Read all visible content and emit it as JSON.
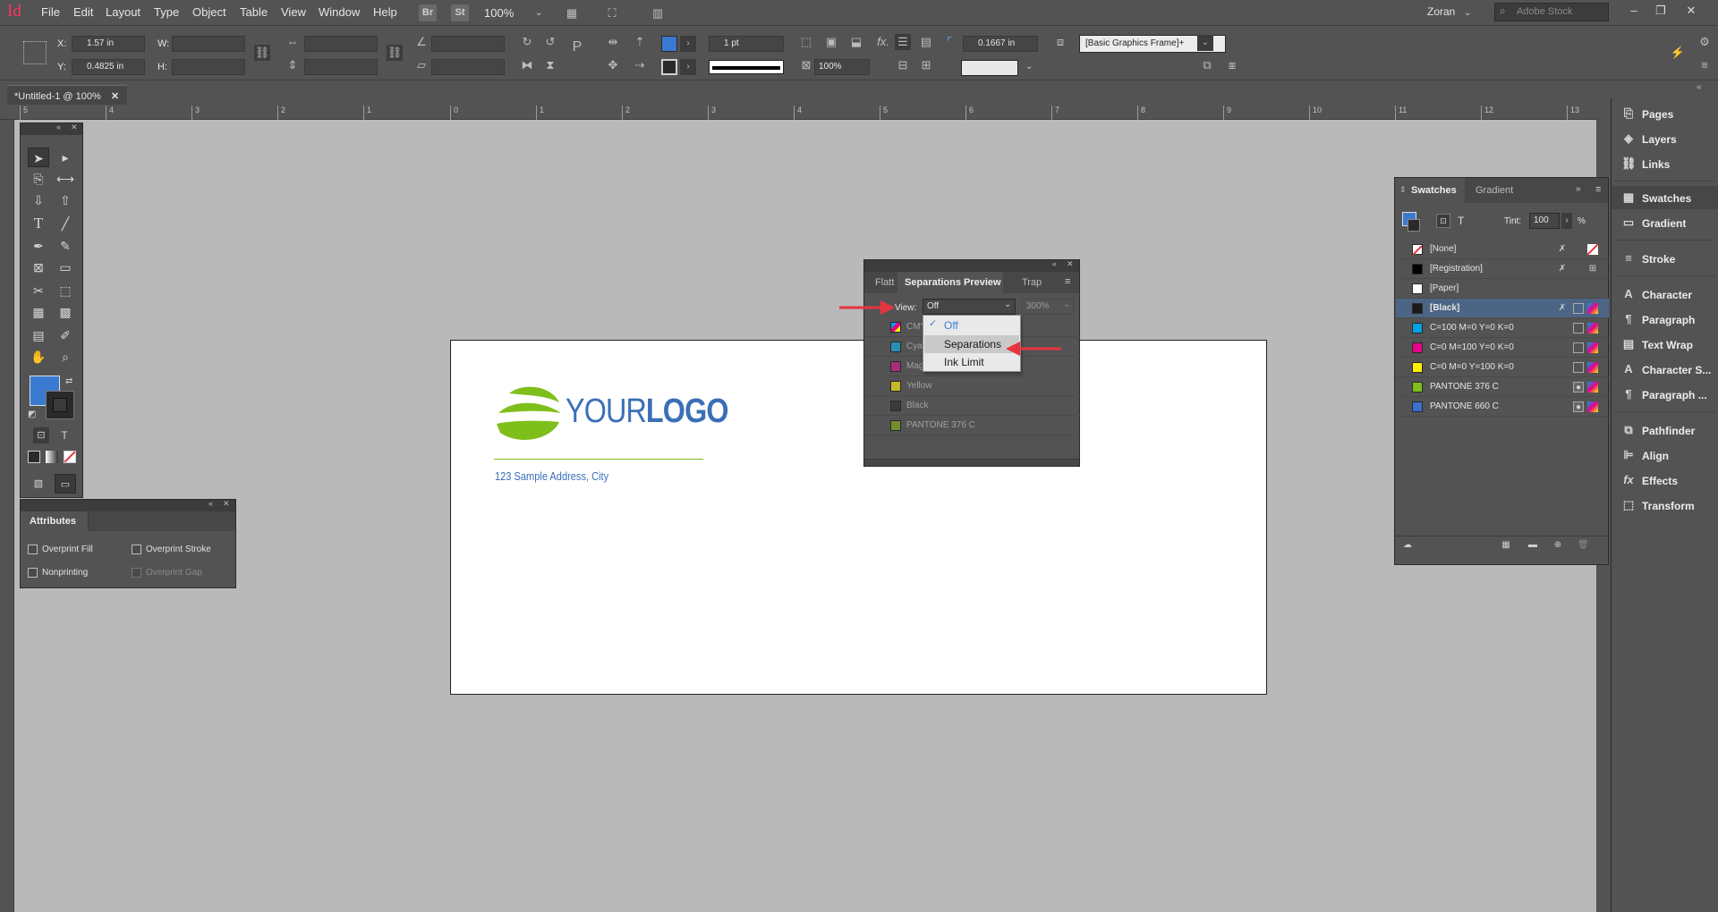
{
  "menubar": {
    "app_icon": "Id",
    "items": [
      "File",
      "Edit",
      "Layout",
      "Type",
      "Object",
      "Table",
      "View",
      "Window",
      "Help"
    ],
    "bridge": "Br",
    "stock": "St",
    "zoom": "100%",
    "user": "Zoran",
    "search_placeholder": "Adobe Stock"
  },
  "controlbar": {
    "x_label": "X:",
    "x_value": "1.57 in",
    "y_label": "Y:",
    "y_value": "0.4825 in",
    "w_label": "W:",
    "h_label": "H:",
    "stroke_weight": "1 pt",
    "scale": "100%",
    "offset": "0.1667 in",
    "object_style": "[Basic Graphics Frame]+"
  },
  "document_tab": {
    "title": "*Untitled-1 @ 100%",
    "close": "✕"
  },
  "ruler_labels": [
    "5",
    "4",
    "3",
    "2",
    "1",
    "0",
    "1",
    "2",
    "3",
    "4",
    "5",
    "6",
    "7",
    "8",
    "9",
    "10",
    "11",
    "12",
    "13"
  ],
  "canvas": {
    "logo_text_regular": "YOUR",
    "logo_text_bold": "LOGO",
    "address": "123 Sample Address, City"
  },
  "attributes": {
    "title": "Attributes",
    "overprint_fill": "Overprint Fill",
    "overprint_stroke": "Overprint Stroke",
    "nonprinting": "Nonprinting",
    "overprint_gap": "Overprint Gap"
  },
  "separations": {
    "tab_flatt": "Flatt",
    "tab_title": "Separations Preview",
    "tab_trap": "Trap",
    "view_label": "View:",
    "view_value": "Off",
    "zoom_value": "300%",
    "rows": [
      {
        "name": "CMY",
        "color": "#9a6cbf"
      },
      {
        "name": "Cyan",
        "color": "#2a8fb5"
      },
      {
        "name": "Mag",
        "color": "#a82d7a"
      },
      {
        "name": "Yellow",
        "color": "#c4b829"
      },
      {
        "name": "Black",
        "color": "#3a3a3a"
      },
      {
        "name": "PANTONE 376 C",
        "color": "#6e8f2c"
      }
    ],
    "dropdown": [
      "Off",
      "Separations",
      "Ink Limit"
    ]
  },
  "swatches": {
    "tab_swatches": "Swatches",
    "tab_gradient": "Gradient",
    "tint_label": "Tint:",
    "tint_value": "100",
    "percent": "%",
    "items": [
      {
        "name": "[None]",
        "color": "#ffffff",
        "none": true
      },
      {
        "name": "[Registration]",
        "color": "#000000"
      },
      {
        "name": "[Paper]",
        "color": "#ffffff"
      },
      {
        "name": "[Black]",
        "color": "#1a1a1a"
      },
      {
        "name": "C=100 M=0 Y=0 K=0",
        "color": "#00a0e6"
      },
      {
        "name": "C=0 M=100 Y=0 K=0",
        "color": "#e6008a"
      },
      {
        "name": "C=0 M=0 Y=100 K=0",
        "color": "#fff000"
      },
      {
        "name": "PANTONE 376 C",
        "color": "#7fbf1b"
      },
      {
        "name": "PANTONE 660 C",
        "color": "#3a6fd0"
      }
    ]
  },
  "dock": {
    "items": [
      "Pages",
      "Layers",
      "Links",
      "Swatches",
      "Gradient",
      "Stroke",
      "Character",
      "Paragraph",
      "Text Wrap",
      "Character S...",
      "Paragraph ...",
      "Pathfinder",
      "Align",
      "Effects",
      "Transform"
    ]
  },
  "colors": {
    "accent": "#3d7fd6",
    "logo_blue": "#3a6fb8",
    "logo_green": "#7fbf1b",
    "arrow_red": "#e8343f"
  }
}
